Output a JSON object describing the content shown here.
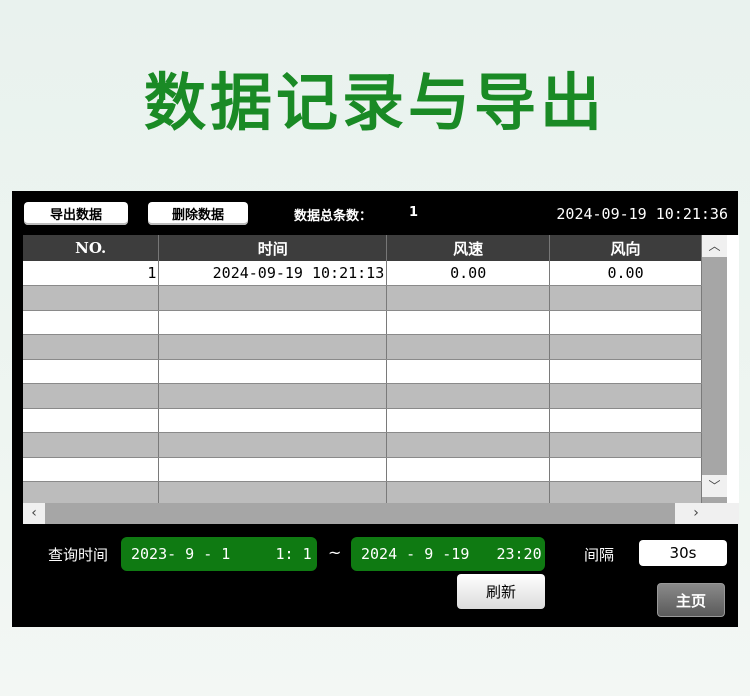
{
  "headline": "数据记录与导出",
  "toolbar": {
    "export_label": "导出数据",
    "delete_label": "删除数据",
    "total_label": "数据总条数：",
    "total_value": "1",
    "clock": "2024-09-19 10:21:36"
  },
  "table": {
    "headers": [
      "NO.",
      "时间",
      "风速",
      "风向"
    ],
    "rows": [
      {
        "no": "1",
        "time": "2024-09-19 10:21:13",
        "speed": "0.00",
        "dir": "0.00"
      }
    ]
  },
  "scrollbar": {
    "up_icon": "chevron-up-icon",
    "down_icon": "chevron-down-icon",
    "left_icon": "chevron-left-icon",
    "right_icon": "chevron-right-icon"
  },
  "query": {
    "label": "查询时间",
    "start": "2023- 9 - 1     1: 1",
    "separator": "~",
    "end": "2024 - 9 -19   23:20",
    "interval_label": "间隔",
    "interval_value": "30s",
    "refresh_label": "刷新",
    "home_label": "主页"
  },
  "colors": {
    "headline": "#1a8a25",
    "date_box": "#0f7a12",
    "panel": "#000000"
  }
}
